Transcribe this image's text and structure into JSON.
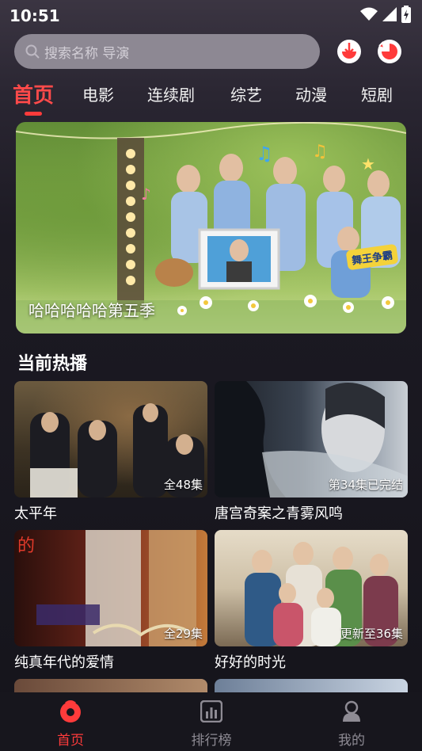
{
  "status_bar": {
    "time": "10:51"
  },
  "search": {
    "placeholder": "搜索名称 导演"
  },
  "tabs": [
    {
      "label": "首页",
      "active": true
    },
    {
      "label": "电影"
    },
    {
      "label": "连续剧"
    },
    {
      "label": "综艺"
    },
    {
      "label": "动漫"
    },
    {
      "label": "短剧"
    }
  ],
  "banner": {
    "title": "哈哈哈哈哈第五季",
    "badge_text": "舞王争霸"
  },
  "section": {
    "title": "当前热播"
  },
  "cards": [
    {
      "title": "太平年",
      "badge": "全48集"
    },
    {
      "title": "唐宫奇案之青雾风鸣",
      "badge": "第34集已完结"
    },
    {
      "title": "纯真年代的爱情",
      "badge": "全29集",
      "poster_text": "的"
    },
    {
      "title": "好好的时光",
      "badge": "更新至36集"
    }
  ],
  "bottom_nav": [
    {
      "label": "首页",
      "active": true
    },
    {
      "label": "排行榜"
    },
    {
      "label": "我的"
    }
  ],
  "colors": {
    "accent": "#ff3b3b",
    "background": "#15141b"
  }
}
